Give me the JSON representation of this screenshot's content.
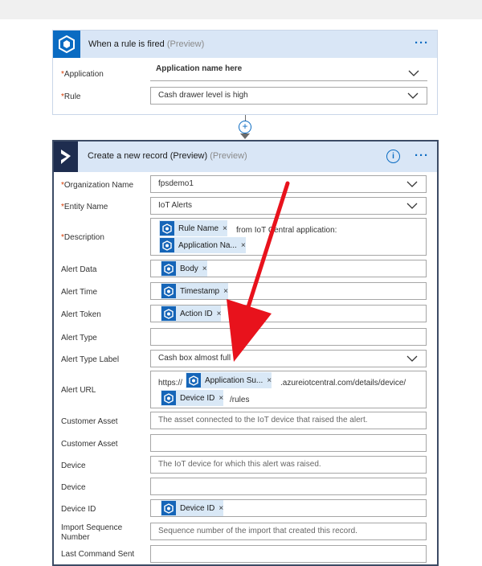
{
  "trigger": {
    "title": "When a rule is fired",
    "preview": "(Preview)",
    "application_label": "Application",
    "application_value": "Application name here",
    "rule_label": "Rule",
    "rule_value": "Cash drawer level is high"
  },
  "action": {
    "title": "Create a new record (Preview)",
    "preview": "(Preview)",
    "fields": {
      "org_label": "Organization Name",
      "org_value": "fpsdemo1",
      "entity_label": "Entity Name",
      "entity_value": "IoT Alerts",
      "desc_label": "Description",
      "desc_token1": "Rule Name",
      "desc_text": "from IoT Central application:",
      "desc_token2": "Application Na...",
      "alert_data_label": "Alert Data",
      "alert_data_token": "Body",
      "alert_time_label": "Alert Time",
      "alert_time_token": "Timestamp",
      "alert_token_label": "Alert Token",
      "alert_token_token": "Action ID",
      "alert_type_label": "Alert Type",
      "alert_type_label_label": "Alert Type Label",
      "alert_type_label_value": "Cash box almost full",
      "alert_url_label": "Alert URL",
      "url_prefix": "https://",
      "url_token1": "Application Su...",
      "url_mid": ".azureiotcentral.com/details/device/",
      "url_token2": "Device ID",
      "url_suffix": "/rules",
      "customer_asset_label": "Customer Asset",
      "customer_asset_ph": "The asset connected to the IoT device that raised the alert.",
      "customer_asset2_label": "Customer Asset",
      "device_label": "Device",
      "device_ph": "The IoT device for which this alert was raised.",
      "device2_label": "Device",
      "device_id_label": "Device ID",
      "device_id_token": "Device ID",
      "import_seq_label_1": "Import Sequence",
      "import_seq_label_2": "Number",
      "import_seq_ph": "Sequence number of the import that created this record.",
      "last_cmd_label": "Last Command Sent"
    }
  },
  "colors": {
    "accent": "#0a6bc2",
    "header_bg": "#d9e6f6",
    "token_bg": "#d9e8f6",
    "annotation_red": "#e8121c"
  }
}
